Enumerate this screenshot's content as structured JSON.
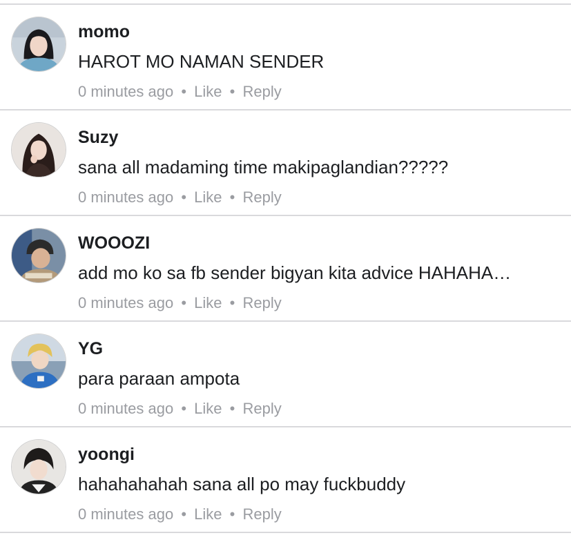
{
  "comments": [
    {
      "name": "momo",
      "text": "HAROT MO NAMAN SENDER",
      "time": "0 minutes ago",
      "like": "Like",
      "reply": "Reply",
      "separator": "•",
      "avatar_icon": "user-avatar-photo"
    },
    {
      "name": "Suzy",
      "text": "sana all madaming time makipaglandian?????",
      "time": "0 minutes ago",
      "like": "Like",
      "reply": "Reply",
      "separator": "•",
      "avatar_icon": "user-avatar-photo"
    },
    {
      "name": "WOOOZI",
      "text": "add mo ko sa fb sender bigyan kita advice HAHAHA…",
      "time": "0 minutes ago",
      "like": "Like",
      "reply": "Reply",
      "separator": "•",
      "avatar_icon": "user-avatar-photo"
    },
    {
      "name": "YG",
      "text": "para paraan ampota",
      "time": "0 minutes ago",
      "like": "Like",
      "reply": "Reply",
      "separator": "•",
      "avatar_icon": "user-avatar-photo"
    },
    {
      "name": "yoongi",
      "text": "hahahahahah sana all po may fuckbuddy",
      "time": "0 minutes ago",
      "like": "Like",
      "reply": "Reply",
      "separator": "•",
      "avatar_icon": "user-avatar-photo"
    }
  ],
  "colors": {
    "text": "#1c1e21",
    "meta": "#9a9ca1",
    "divider": "#d9d9dc"
  }
}
